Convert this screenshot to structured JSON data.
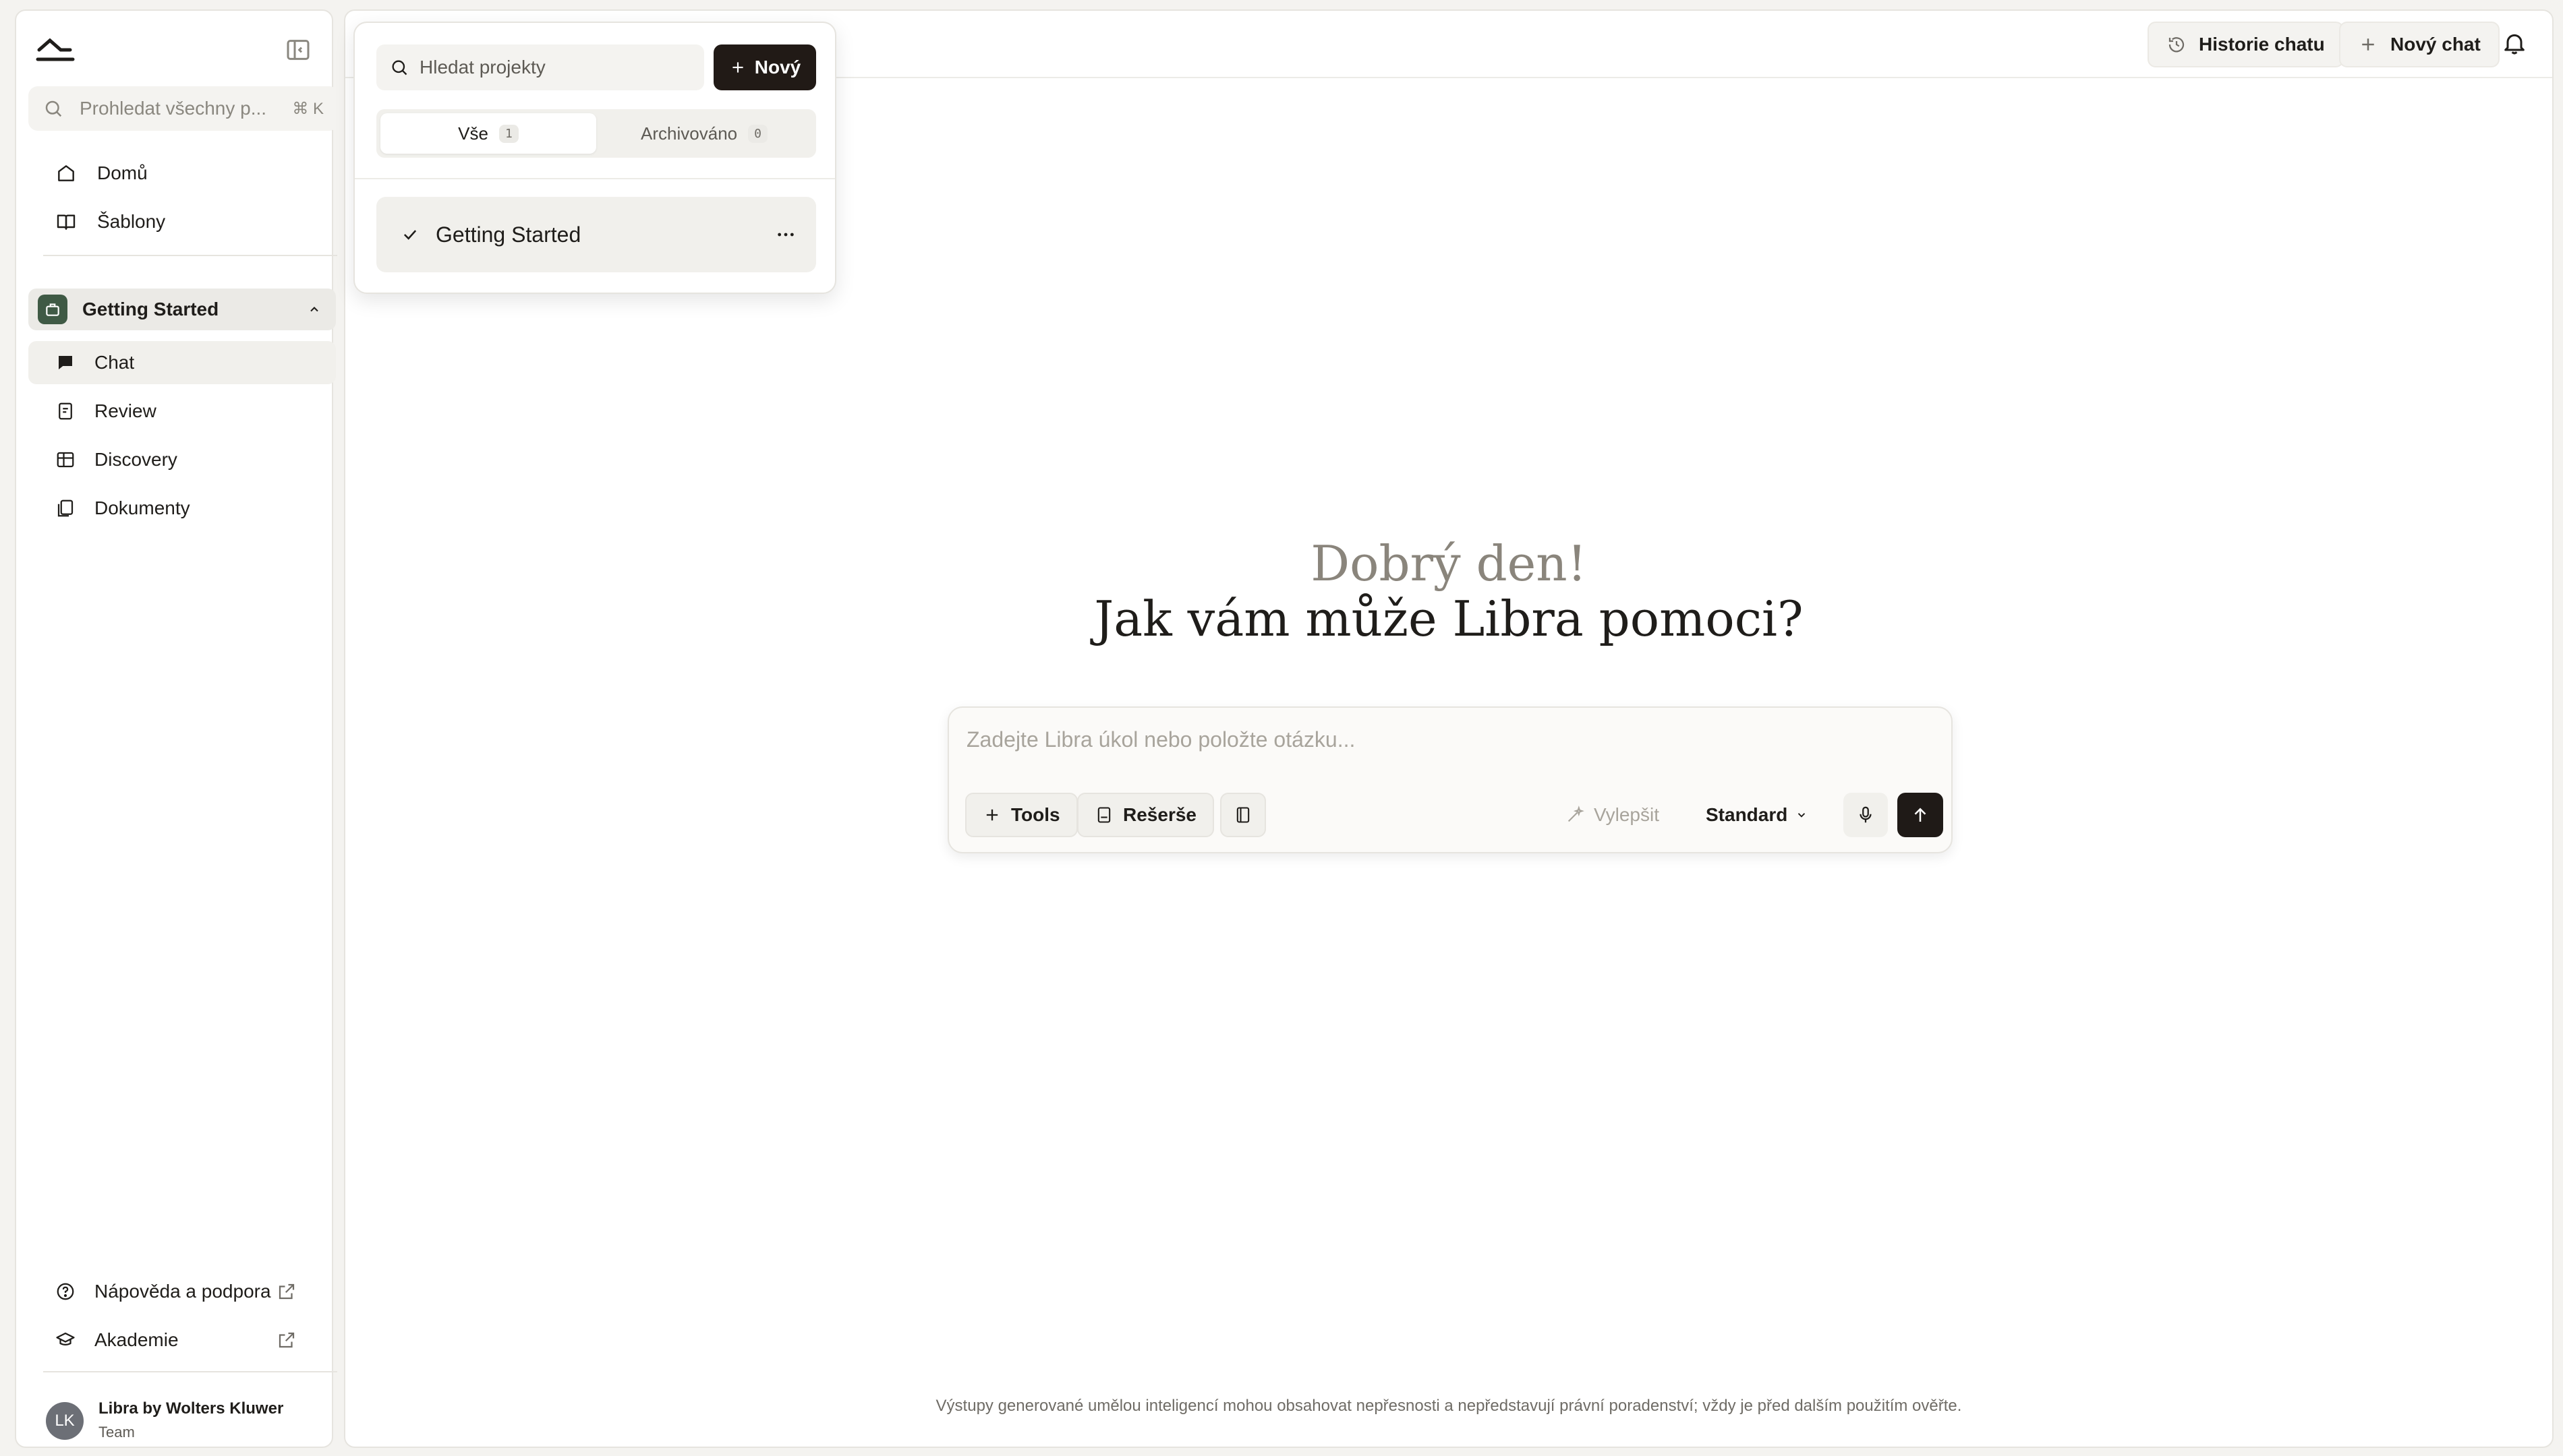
{
  "sidebar": {
    "search_placeholder": "Prohledat všechny p...",
    "search_shortcut": "⌘ K",
    "nav": [
      {
        "label": "Domů",
        "icon": "home-icon"
      },
      {
        "label": "Šablony",
        "icon": "book-icon"
      }
    ],
    "project": {
      "name": "Getting Started"
    },
    "project_items": [
      {
        "label": "Chat",
        "icon": "chat-icon",
        "active": true
      },
      {
        "label": "Review",
        "icon": "review-icon"
      },
      {
        "label": "Discovery",
        "icon": "table-icon"
      },
      {
        "label": "Dokumenty",
        "icon": "documents-icon"
      }
    ],
    "footer": [
      {
        "label": "Nápověda a podpora",
        "icon": "help-icon"
      },
      {
        "label": "Akademie",
        "icon": "academy-icon"
      }
    ],
    "user": {
      "initials": "LK",
      "name": "Libra by Wolters Kluwer",
      "plan": "Team"
    }
  },
  "topbar": {
    "history_label": "Historie chatu",
    "new_chat_label": "Nový chat"
  },
  "greeting": {
    "line1": "Dobrý den!",
    "line2": "Jak vám může Libra pomoci?"
  },
  "composer": {
    "placeholder": "Zadejte Libra úkol nebo položte otázku...",
    "tools_label": "Tools",
    "research_label": "Rešerše",
    "improve_label": "Vylepšit",
    "mode_label": "Standard"
  },
  "disclaimer": "Výstupy generované umělou inteligencí mohou obsahovat nepřesnosti a nepředstavují právní poradenství; vždy je před dalším použitím ověřte.",
  "popover": {
    "search_placeholder": "Hledat projekty",
    "new_label": "Nový",
    "tabs": [
      {
        "label": "Vše",
        "count": "1",
        "active": true
      },
      {
        "label": "Archivováno",
        "count": "0"
      }
    ],
    "items": [
      {
        "label": "Getting Started",
        "selected": true
      }
    ]
  }
}
